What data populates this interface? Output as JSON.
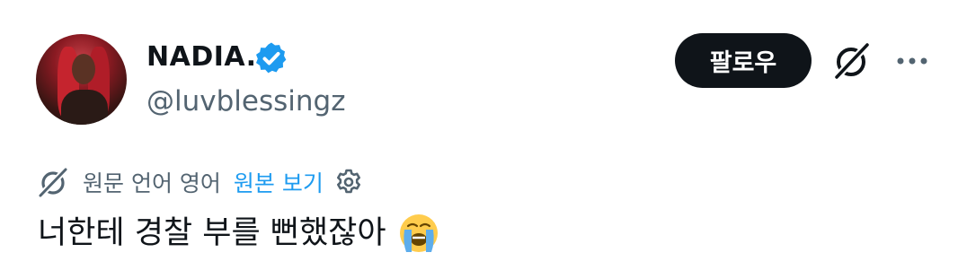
{
  "user": {
    "display_name": "NADIA.",
    "handle": "@luvblessingz",
    "verified": true,
    "avatar": "avatar-photo-red-hair"
  },
  "header": {
    "follow_label": "팔로우",
    "icons": [
      "grok-icon",
      "more-icon"
    ]
  },
  "translation": {
    "info": "원문 언어 영어",
    "show_original": "원본 보기",
    "icons": [
      "translate-icon",
      "settings-gear-icon"
    ]
  },
  "tweet": {
    "text": "너한테 경찰 부를 뻔했잖아",
    "emoji": "loudly-crying-face-emoji"
  },
  "colors": {
    "accent": "#1d9bf0",
    "text": "#0f1419",
    "secondary": "#536471",
    "button_bg": "#0f1419"
  }
}
